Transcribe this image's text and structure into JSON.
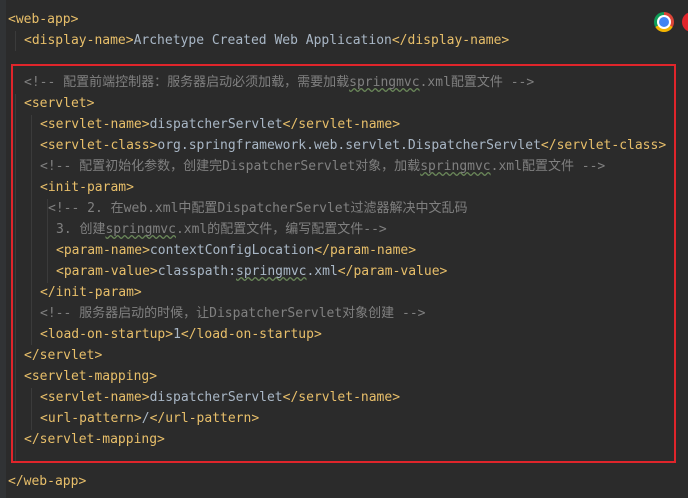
{
  "editor": {
    "lines": [
      {
        "indent": 0,
        "parts": [
          [
            "t",
            "<web-app>"
          ]
        ]
      },
      {
        "indent": 1,
        "parts": [
          [
            "t",
            "<display-name>"
          ],
          [
            "x",
            "Archetype Created Web Application"
          ],
          [
            "t",
            "</display-name>"
          ]
        ]
      },
      {
        "indent": 0,
        "parts": []
      },
      {
        "indent": 1,
        "parts": [
          [
            "c",
            "<!-- 配置前端控制器：服务器启动必须加载，需要加载"
          ],
          [
            "cs",
            "springmvc"
          ],
          [
            "c",
            ".xml配置文件 -->"
          ]
        ]
      },
      {
        "indent": 1,
        "parts": [
          [
            "t",
            "<servlet>"
          ]
        ]
      },
      {
        "indent": 2,
        "parts": [
          [
            "t",
            "<servlet-name>"
          ],
          [
            "x",
            "dispatcherServlet"
          ],
          [
            "t",
            "</servlet-name>"
          ]
        ]
      },
      {
        "indent": 2,
        "parts": [
          [
            "t",
            "<servlet-class>"
          ],
          [
            "x",
            "org.springframework.web.servlet.DispatcherServlet"
          ],
          [
            "t",
            "</servlet-class>"
          ]
        ]
      },
      {
        "indent": 2,
        "parts": [
          [
            "c",
            "<!-- 配置初始化参数，创建完DispatcherServlet对象，加载"
          ],
          [
            "cs",
            "springmvc"
          ],
          [
            "c",
            ".xml配置文件 -->"
          ]
        ]
      },
      {
        "indent": 2,
        "parts": [
          [
            "t",
            "<init-param>"
          ]
        ]
      },
      {
        "indent": 2.5,
        "parts": [
          [
            "c",
            "<!-- 2. 在web.xml中配置DispatcherServlet过滤器解决中文乱码"
          ]
        ]
      },
      {
        "indent": 3,
        "parts": [
          [
            "c",
            "3. 创建"
          ],
          [
            "cs",
            "springmvc"
          ],
          [
            "c",
            ".xml的配置文件，编写配置文件-->"
          ]
        ]
      },
      {
        "indent": 3,
        "parts": [
          [
            "t",
            "<param-name>"
          ],
          [
            "x",
            "contextConfigLocation"
          ],
          [
            "t",
            "</param-name>"
          ]
        ]
      },
      {
        "indent": 3,
        "parts": [
          [
            "t",
            "<param-value>"
          ],
          [
            "x",
            "classpath:"
          ],
          [
            "xs",
            "springmvc"
          ],
          [
            "x",
            ".xml"
          ],
          [
            "t",
            "</param-value>"
          ]
        ]
      },
      {
        "indent": 2,
        "parts": [
          [
            "t",
            "</init-param>"
          ]
        ]
      },
      {
        "indent": 2,
        "parts": [
          [
            "c",
            "<!-- 服务器启动的时候，让DispatcherServlet对象创建 -->"
          ]
        ]
      },
      {
        "indent": 2,
        "parts": [
          [
            "t",
            "<load-on-startup>"
          ],
          [
            "x",
            "1"
          ],
          [
            "t",
            "</load-on-startup>"
          ]
        ]
      },
      {
        "indent": 1,
        "parts": [
          [
            "t",
            "</servlet>"
          ]
        ]
      },
      {
        "indent": 1,
        "parts": [
          [
            "t",
            "<servlet-mapping>"
          ]
        ]
      },
      {
        "indent": 2,
        "parts": [
          [
            "t",
            "<servlet-name>"
          ],
          [
            "x",
            "dispatcherServlet"
          ],
          [
            "t",
            "</servlet-name>"
          ]
        ]
      },
      {
        "indent": 2,
        "parts": [
          [
            "t",
            "<url-pattern>"
          ],
          [
            "x",
            "/"
          ],
          [
            "t",
            "</url-pattern>"
          ]
        ]
      },
      {
        "indent": 1,
        "parts": [
          [
            "t",
            "</servlet-mapping>"
          ]
        ]
      },
      {
        "indent": 0,
        "parts": []
      },
      {
        "indent": 0,
        "parts": [
          [
            "t",
            "</web-app>"
          ]
        ]
      }
    ],
    "colors": {
      "background": "#2b2b2b",
      "tag": "#e8bf6a",
      "text": "#a9b7c6",
      "comment": "#808080",
      "highlight_border": "#e0252b"
    }
  },
  "browser_icons": [
    "chrome-icon",
    "opera-icon"
  ]
}
